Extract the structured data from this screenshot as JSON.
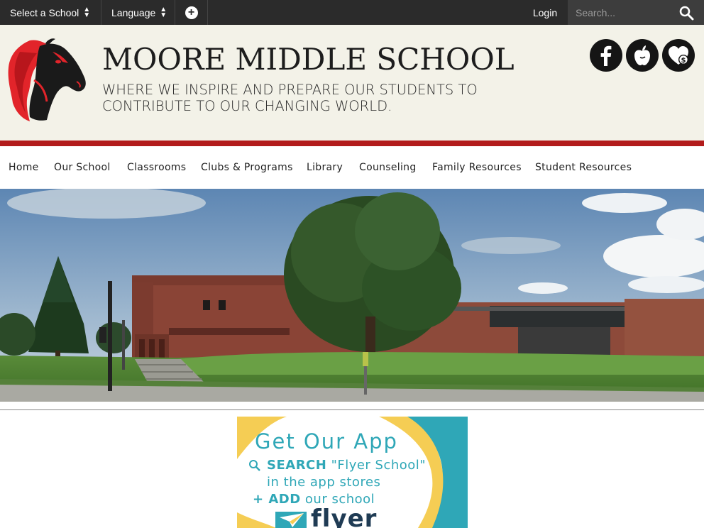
{
  "topbar": {
    "school_select": "Select a School",
    "language_select": "Language",
    "login": "Login",
    "search_placeholder": "Search..."
  },
  "header": {
    "school_name": "MOORE MIDDLE SCHOOL",
    "tagline_line1": "WHERE WE INSPIRE AND PREPARE OUR STUDENTS TO",
    "tagline_line2": "CONTRIBUTE TO OUR CHANGING WORLD."
  },
  "social": {
    "items": [
      {
        "icon": "facebook-icon"
      },
      {
        "icon": "apple-icon"
      },
      {
        "icon": "heart-money-icon"
      }
    ]
  },
  "nav": {
    "items": [
      {
        "label": "Home"
      },
      {
        "label": "Our School"
      },
      {
        "label": "Classrooms"
      },
      {
        "label": "Clubs & Programs"
      },
      {
        "label": "Library"
      },
      {
        "label": "Counseling"
      },
      {
        "label": "Family Resources"
      },
      {
        "label": "Student Resources"
      }
    ]
  },
  "app_banner": {
    "title": "Get Our App",
    "search_word": "SEARCH",
    "search_query": "\"Flyer School\"",
    "line2": "in the app stores",
    "add_word": "+ ADD",
    "add_rest": "our school",
    "brand": "flyer"
  },
  "colors": {
    "topbar": "#2b2b2b",
    "header_bg": "#f3f2e8",
    "accent_red": "#b21b1b",
    "app_teal": "#2fa7b7",
    "app_yellow": "#f5cd54"
  }
}
